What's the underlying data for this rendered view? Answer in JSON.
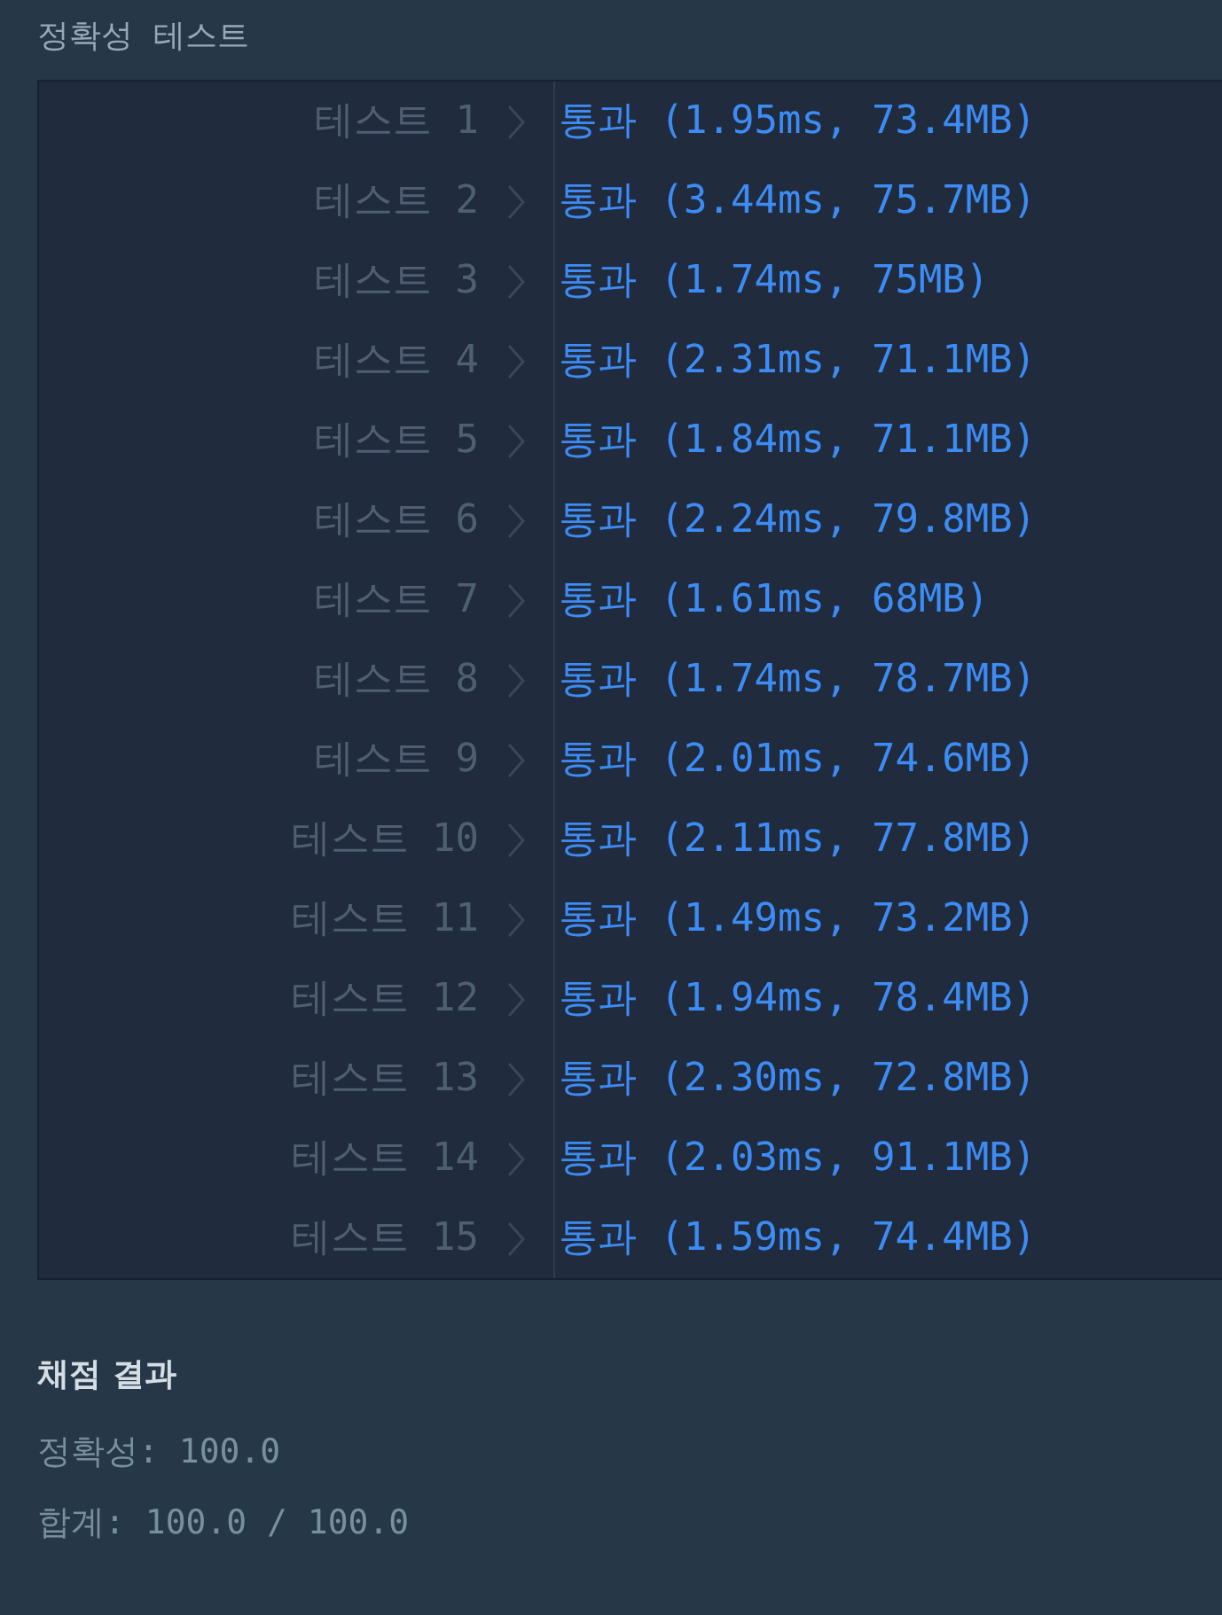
{
  "header": {
    "title": "정확성  테스트"
  },
  "tests": [
    {
      "label": "테스트 1",
      "result": "통과 (1.95ms, 73.4MB)",
      "kind": "pass"
    },
    {
      "label": "테스트 2",
      "result": "통과 (3.44ms, 75.7MB)",
      "kind": "pass"
    },
    {
      "label": "테스트 3",
      "result": "통과 (1.74ms, 75MB)",
      "kind": "pass"
    },
    {
      "label": "테스트 4",
      "result": "통과 (2.31ms, 71.1MB)",
      "kind": "pass"
    },
    {
      "label": "테스트 5",
      "result": "통과 (1.84ms, 71.1MB)",
      "kind": "pass"
    },
    {
      "label": "테스트 6",
      "result": "통과 (2.24ms, 79.8MB)",
      "kind": "pass"
    },
    {
      "label": "테스트 7",
      "result": "통과 (1.61ms, 68MB)",
      "kind": "pass"
    },
    {
      "label": "테스트 8",
      "result": "통과 (1.74ms, 78.7MB)",
      "kind": "pass"
    },
    {
      "label": "테스트 9",
      "result": "통과 (2.01ms, 74.6MB)",
      "kind": "pass"
    },
    {
      "label": "테스트 10",
      "result": "통과 (2.11ms, 77.8MB)",
      "kind": "pass"
    },
    {
      "label": "테스트 11",
      "result": "통과 (1.49ms, 73.2MB)",
      "kind": "pass"
    },
    {
      "label": "테스트 12",
      "result": "통과 (1.94ms, 78.4MB)",
      "kind": "pass"
    },
    {
      "label": "테스트 13",
      "result": "통과 (2.30ms, 72.8MB)",
      "kind": "pass"
    },
    {
      "label": "테스트 14",
      "result": "통과 (2.03ms, 91.1MB)",
      "kind": "pass"
    },
    {
      "label": "테스트 15",
      "result": "통과 (1.59ms, 74.4MB)",
      "kind": "pass"
    }
  ],
  "summary": {
    "title": "채점 결과",
    "accuracy": "정확성: 100.0",
    "total": "합계: 100.0 / 100.0"
  }
}
